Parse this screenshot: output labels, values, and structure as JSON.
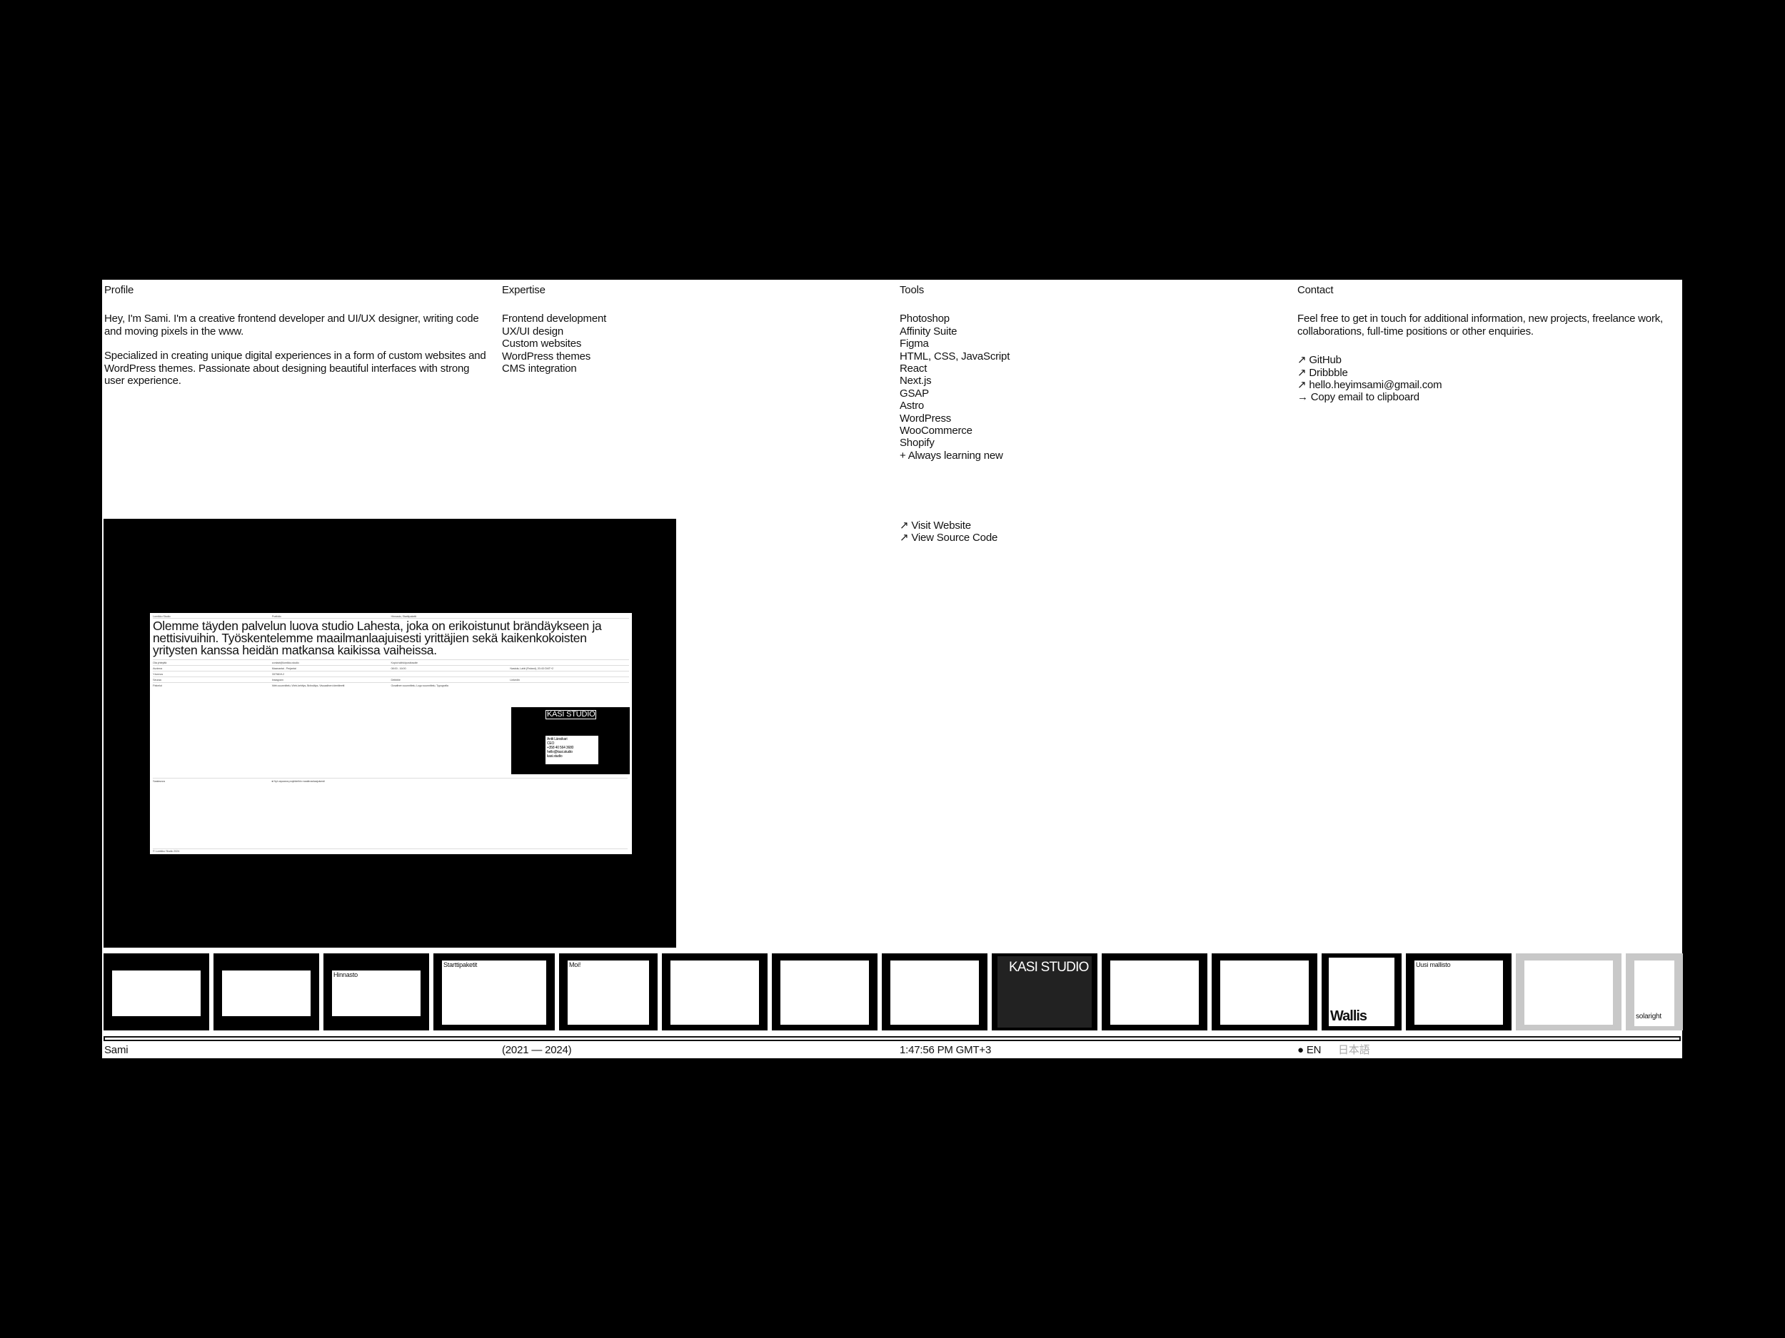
{
  "profile": {
    "heading": "Profile",
    "p1": "Hey, I'm Sami. I'm a creative frontend developer and UI/UX designer, writing code and moving pixels in the www.",
    "p2": "Specialized in creating unique digital experiences in a form of custom websites and WordPress themes. Passionate about designing beautiful interfaces with strong user experience."
  },
  "expertise": {
    "heading": "Expertise",
    "items": [
      "Frontend development",
      "UX/UI design",
      "Custom websites",
      "WordPress themes",
      "CMS integration"
    ]
  },
  "tools": {
    "heading": "Tools",
    "items": [
      "Photoshop",
      "Affinity Suite",
      "Figma",
      "HTML, CSS, JavaScript",
      "React",
      "Next.js",
      "GSAP",
      "Astro",
      "WordPress",
      "WooCommerce",
      "Shopify",
      "+ Always learning new"
    ]
  },
  "contact": {
    "heading": "Contact",
    "text": "Feel free to get in touch for additional information, new projects, freelance work, collaborations, full-time positions or other enquiries.",
    "links": [
      "↗ GitHub",
      "↗ Dribbble",
      "↗ hello.heyimsami@gmail.com",
      "→ Copy email to clipboard"
    ]
  },
  "project_links": {
    "visit": "↗ Visit Website",
    "source": "↗ View Source Code"
  },
  "preview": {
    "header": [
      "Lumikko Studio",
      "Portfolio",
      "Hinnasto, Starttipaketit",
      ""
    ],
    "headline": "Olemme täyden palvelun luova studio Lahesta, joka on erikoistunut brändäykseen ja nettisivuihin. Työskentelemme maailmanlaajuisesti yrittäjien sekä kaikenkokoisten yritysten kanssa heidän matkansa kaikissa vaiheissa.",
    "rows": [
      [
        "Ota yhteyttä",
        "contact@lumikko.studio",
        "Kopioi sähköpostiosoite",
        ""
      ],
      [
        "Avoinna",
        "Maanantai - Perjantai",
        "08:00 - 16:00",
        "Nastola, Lahti (Finland), 20:43 GMT+2"
      ],
      [
        "Y-tunnus",
        "3375819-2",
        "",
        ""
      ],
      [
        "Seuraa",
        "Instagram",
        "Dribbble",
        "LinkedIn"
      ],
      [
        "Palvelut",
        "Web-suunnittelu, Web-kehitys, Brändäys, Visuaalinen identiteetti",
        "Graafinen suunnittelu, Logo suunnittelu, Typografia",
        ""
      ]
    ],
    "card": {
      "title": "KASI STUDIO",
      "name": "Antti Länsikari",
      "role": "CEO",
      "phone": "+358 40 564 3680",
      "email": "hello@kasi.studio",
      "site": "kasi.studio"
    },
    "availability": [
      "Saatavuus",
      "● Nyt vapaana projekteihin maailmanlaajuisesti"
    ],
    "footer": "© Lumikko Studio 2024"
  },
  "thumbnails": [
    "",
    "",
    "Hinnasto",
    "Starttipaketit",
    "Moi!",
    "",
    "",
    "",
    "KASI STUDIO",
    "",
    "",
    "Wallis",
    "Uusi mallisto",
    "",
    "solaright"
  ],
  "footer": {
    "name": "Sami",
    "years": "(2021 — 2024)",
    "time": "1:47:56 PM GMT+3",
    "lang_active": "● EN",
    "lang_other": "日本語"
  }
}
